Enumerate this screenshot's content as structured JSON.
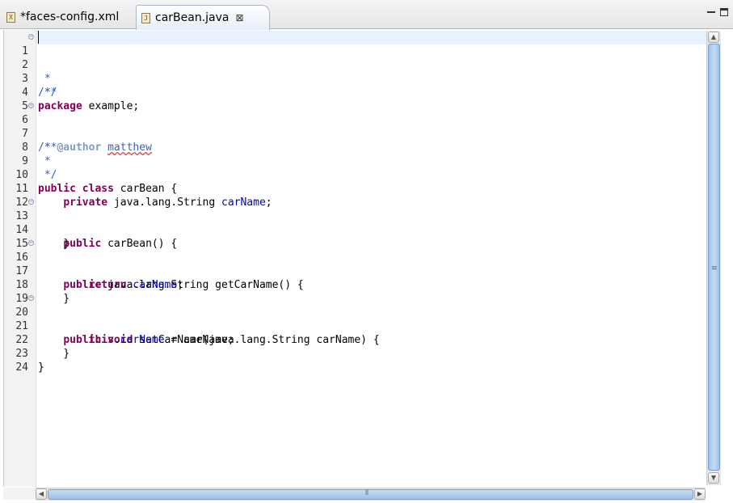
{
  "tabs": [
    {
      "label": "*faces-config.xml",
      "icon": "xml-file-icon",
      "active": false
    },
    {
      "label": "carBean.java",
      "icon": "java-file-icon",
      "active": true
    }
  ],
  "lines": [
    {
      "n": "1",
      "fold": true
    },
    {
      "n": "2"
    },
    {
      "n": "3"
    },
    {
      "n": "4"
    },
    {
      "n": "5"
    },
    {
      "n": "6",
      "fold": true
    },
    {
      "n": "7"
    },
    {
      "n": "8"
    },
    {
      "n": "9"
    },
    {
      "n": "10"
    },
    {
      "n": "11"
    },
    {
      "n": "12"
    },
    {
      "n": "13",
      "fold": true
    },
    {
      "n": "14"
    },
    {
      "n": "15"
    },
    {
      "n": "16",
      "fold": true
    },
    {
      "n": "17"
    },
    {
      "n": "18"
    },
    {
      "n": "19"
    },
    {
      "n": "20",
      "fold": true
    },
    {
      "n": "21"
    },
    {
      "n": "22"
    },
    {
      "n": "23"
    },
    {
      "n": "24"
    }
  ],
  "code": {
    "l1": "/**",
    "l2": " *",
    "l3": " */",
    "l4_kw": "package",
    "l4_rest": " example;",
    "l6": "/**",
    "l7_star": " * ",
    "l7_tag": "@author",
    "l7_sp": " ",
    "l7_name": "matthew",
    "l8": " *",
    "l9": " */",
    "l10_kw1": "public",
    "l10_kw2": "class",
    "l10_rest": " carBean {",
    "l11_kw": "private",
    "l11_type": " java.lang.String ",
    "l11_field": "carName",
    "l11_end": ";",
    "l13_kw": "public",
    "l13_rest": " carBean() {",
    "l14": "    }",
    "l16_kw": "public",
    "l16_rest": " java.lang.String getCarName() {",
    "l17_kw": "return",
    "l17_field": "carName",
    "l17_end": ";",
    "l18": "    }",
    "l20_kw1": "public",
    "l20_kw2": "void",
    "l20_rest": " setCarName(java.lang.String carName) {",
    "l21_kw": "this",
    "l21_dot": ".",
    "l21_field": "carName",
    "l21_rest": " = carName;",
    "l22": "    }",
    "l23": "}"
  },
  "colors": {
    "keyword": "#7f0055",
    "comment": "#3f5fbf",
    "javadoc_tag": "#7f9fbf",
    "field": "#0000c0",
    "current_line": "#e8f2fe"
  }
}
